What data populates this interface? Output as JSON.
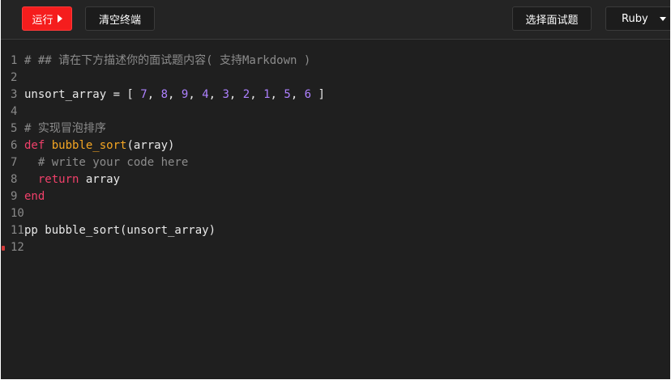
{
  "toolbar": {
    "run_label": "运行",
    "clear_label": "清空终端",
    "select_label": "选择面试题",
    "language_label": "Ruby"
  },
  "editor": {
    "lines": [
      {
        "number": "1",
        "segments": [
          {
            "text": "# ## 请在下方描述你的面试题内容( 支持Markdown )",
            "type": "comment"
          }
        ]
      },
      {
        "number": "2",
        "segments": []
      },
      {
        "number": "3",
        "segments": [
          {
            "text": "unsort_array = [ ",
            "type": "plain"
          },
          {
            "text": "7",
            "type": "num"
          },
          {
            "text": ", ",
            "type": "plain"
          },
          {
            "text": "8",
            "type": "num"
          },
          {
            "text": ", ",
            "type": "plain"
          },
          {
            "text": "9",
            "type": "num"
          },
          {
            "text": ", ",
            "type": "plain"
          },
          {
            "text": "4",
            "type": "num"
          },
          {
            "text": ", ",
            "type": "plain"
          },
          {
            "text": "3",
            "type": "num"
          },
          {
            "text": ", ",
            "type": "plain"
          },
          {
            "text": "2",
            "type": "num"
          },
          {
            "text": ", ",
            "type": "plain"
          },
          {
            "text": "1",
            "type": "num"
          },
          {
            "text": ", ",
            "type": "plain"
          },
          {
            "text": "5",
            "type": "num"
          },
          {
            "text": ", ",
            "type": "plain"
          },
          {
            "text": "6",
            "type": "num"
          },
          {
            "text": " ]",
            "type": "plain"
          }
        ]
      },
      {
        "number": "4",
        "segments": []
      },
      {
        "number": "5",
        "segments": [
          {
            "text": "# 实现冒泡排序",
            "type": "comment"
          }
        ]
      },
      {
        "number": "6",
        "segments": [
          {
            "text": "def",
            "type": "kw"
          },
          {
            "text": " ",
            "type": "plain"
          },
          {
            "text": "bubble_sort",
            "type": "fn"
          },
          {
            "text": "(array)",
            "type": "plain"
          }
        ]
      },
      {
        "number": "7",
        "segments": [
          {
            "text": "  # write your code here",
            "type": "comment"
          }
        ]
      },
      {
        "number": "8",
        "segments": [
          {
            "text": "  ",
            "type": "plain"
          },
          {
            "text": "return",
            "type": "kw"
          },
          {
            "text": " array",
            "type": "plain"
          }
        ]
      },
      {
        "number": "9",
        "segments": [
          {
            "text": "end",
            "type": "kw"
          }
        ]
      },
      {
        "number": "10",
        "segments": []
      },
      {
        "number": "11",
        "segments": [
          {
            "text": "pp bubble_sort(unsort_array)",
            "type": "plain"
          }
        ]
      },
      {
        "number": "12",
        "segments": [],
        "marker": true
      }
    ]
  },
  "colors": {
    "run_button": "#f51d1d",
    "background": "#1f1f1f",
    "keyword": "#f0406a",
    "function": "#f5a623",
    "number": "#ae81ff",
    "comment": "#8c8c8c"
  }
}
